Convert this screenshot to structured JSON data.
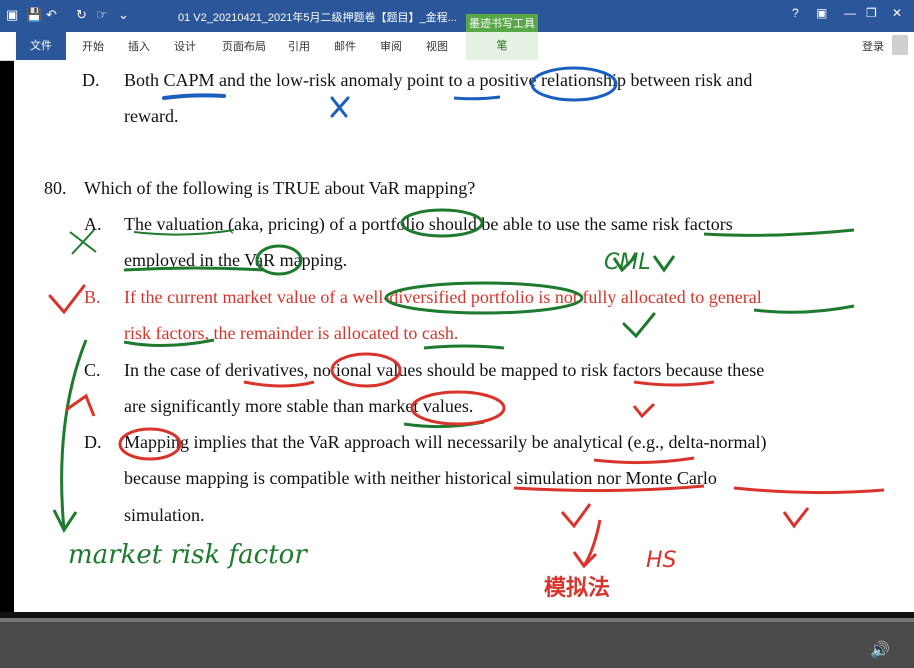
{
  "titlebar": {
    "doc_title": "01 V2_20210421_2021年5月二级押题卷【题目】_金程...",
    "tool_tab": "墨迹书写工具",
    "help": "?",
    "restore": "▣",
    "minimize": "—",
    "maximize": "❐",
    "close": "✕"
  },
  "ribbon": {
    "tabs": [
      "文件",
      "开始",
      "插入",
      "设计",
      "页面布局",
      "引用",
      "邮件",
      "审阅",
      "视图"
    ],
    "pen_tab": "笔",
    "login": "登录"
  },
  "document": {
    "q79_d_label": "D.",
    "q79_d_line1": "Both CAPM and the low-risk anomaly point to a positive relationship between risk and",
    "q79_d_line2": "reward.",
    "q80_number": "80.",
    "q80_stem": "Which of the following is TRUE about VaR mapping?",
    "options": [
      {
        "label": "A.",
        "line1": "The valuation (aka, pricing) of a portfolio should be able to use the same risk factors",
        "line2": "employed in the VaR mapping."
      },
      {
        "label": "B.",
        "line1": "If the current market value of a well-diversified portfolio is not fully allocated to general",
        "line2": "risk factors, the remainder is allocated to cash."
      },
      {
        "label": "C.",
        "line1": "In the case of derivatives, notional values should be mapped to risk factors because these",
        "line2": "are significantly more stable than market values."
      },
      {
        "label": "D.",
        "line1": "Mapping implies that the VaR approach will necessarily be analytical (e.g., delta-normal)",
        "line2": "because mapping is compatible with neither historical simulation nor Monte Carlo",
        "line3": "simulation."
      }
    ]
  },
  "annotations": {
    "cml": "CML",
    "market_risk_factor": "market risk factor",
    "hs": "HS",
    "chinese_note": "模拟法"
  },
  "colors": {
    "title_blue": "#2b579a",
    "ink_blue": "#1a5fbf",
    "ink_green": "#1e7a2e",
    "ink_red": "#d9342b"
  }
}
